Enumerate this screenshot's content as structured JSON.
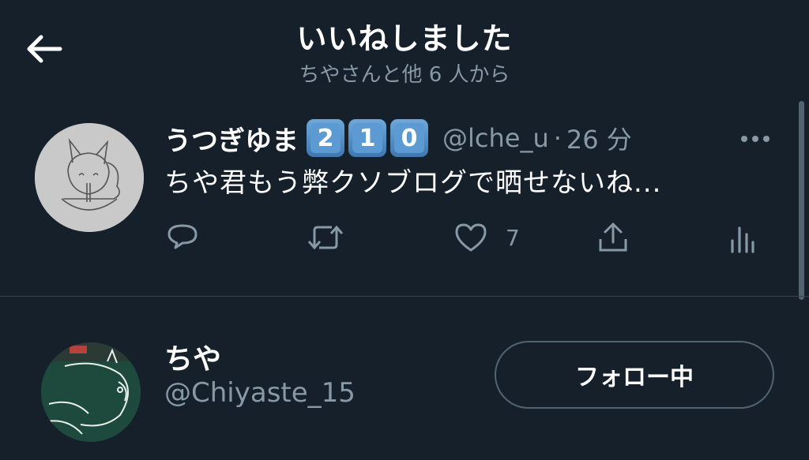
{
  "header": {
    "title": "いいねしました",
    "subtitle": "ちやさんと他 6 人から"
  },
  "tweet": {
    "author_name": "うつぎゆま",
    "name_keycaps": [
      "2",
      "1",
      "0"
    ],
    "handle": "@lche_u",
    "separator": "·",
    "time": "26 分",
    "text": "ちや君もう弊クソブログで晒せないね...",
    "like_count": "7",
    "icons": [
      "reply-icon",
      "retweet-icon",
      "like-icon",
      "share-icon",
      "analytics-icon",
      "more-icon"
    ]
  },
  "liked_user": {
    "name": "ちや",
    "handle": "@Chiyaste_15",
    "follow_label": "フォロー中"
  },
  "colors": {
    "background": "#15202b",
    "secondary_text": "#8899a6",
    "divider": "#38444d"
  }
}
